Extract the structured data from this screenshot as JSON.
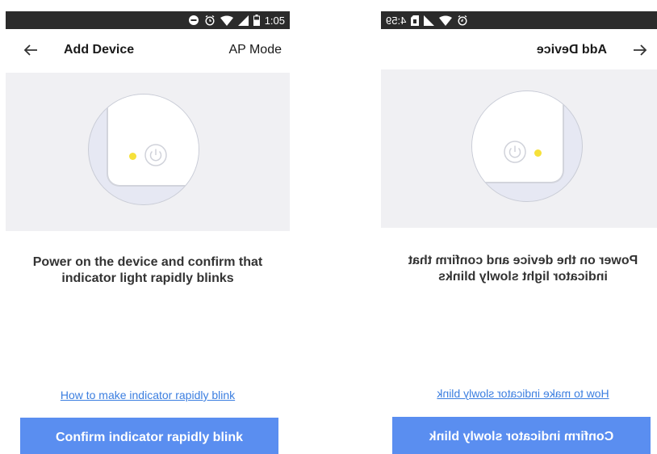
{
  "screens": [
    {
      "status": {
        "time": "1:05"
      },
      "header": {
        "title": "Add Device",
        "action": "AP Mode"
      },
      "instruction": "Power on the device and confirm that indicator light rapidly blinks",
      "help_link": "How to make indicator rapidly blink",
      "confirm_button": "Confirm indicator rapidly blink"
    },
    {
      "status": {
        "time": "4:59"
      },
      "header": {
        "title": "Add Device"
      },
      "instruction": "Power on the device and confirm that indicator light slowly blinks",
      "help_link": "How to make indicator slowly blink",
      "confirm_button": "Confirm indicator slowly blink"
    }
  ],
  "icons": [
    "minus-circle-icon",
    "alarm-icon",
    "wifi-icon",
    "signal-icon",
    "battery-icon",
    "back-arrow-icon",
    "power-icon",
    "sim-icon"
  ],
  "colors": {
    "status_bar": "#2b2b2b",
    "illustration_bg": "#f0f0f3",
    "indicator": "#f6e13a",
    "link": "#3b7ee0",
    "button": "#5a8ef0"
  }
}
